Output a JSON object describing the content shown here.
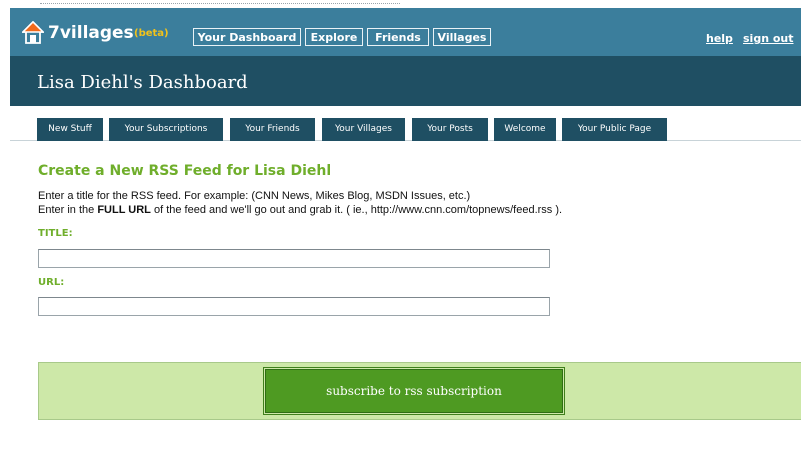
{
  "logo": {
    "name": "7villages",
    "beta": "(beta)"
  },
  "nav": [
    {
      "label": "Your Dashboard"
    },
    {
      "label": "Explore"
    },
    {
      "label": "Friends"
    },
    {
      "label": "Villages"
    }
  ],
  "toplinks": {
    "help": "help",
    "signout": "sign out"
  },
  "dashboard_title": "Lisa Diehl's Dashboard",
  "tabs": [
    {
      "label": "New Stuff"
    },
    {
      "label": "Your Subscriptions"
    },
    {
      "label": "Your Friends"
    },
    {
      "label": "Your Villages"
    },
    {
      "label": "Your Posts"
    },
    {
      "label": "Welcome"
    },
    {
      "label": "Your Public Page"
    }
  ],
  "form": {
    "heading": "Create a New RSS Feed for Lisa Diehl",
    "line1": "Enter a title for the RSS feed. For example: (CNN News, Mikes Blog, MSDN Issues, etc.)",
    "line2_a": "Enter in the ",
    "line2_b": "FULL URL",
    "line2_c": " of the feed and we'll go out and grab it. ( ie., http://www.cnn.com/topnews/feed.rss ).",
    "title_label": "TITLE:",
    "title_value": "",
    "url_label": "URL:",
    "url_value": "",
    "submit_label": "subscribe to rss subscription"
  },
  "colors": {
    "header_blue": "#3b7e9c",
    "dark_teal": "#1f4f63",
    "accent_green": "#6fae2b",
    "button_green": "#4e9a22",
    "panel_green": "#cde8a8",
    "beta_yellow": "#f2c21b"
  }
}
